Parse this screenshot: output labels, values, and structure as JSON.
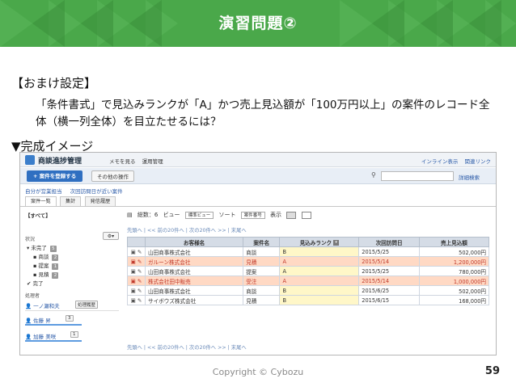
{
  "slide": {
    "title": "演習問題②",
    "heading": "【おまけ設定】",
    "question": "「条件書式」で見込みランクが「A」かつ売上見込額が「100万円以上」の案件のレコード全体（横一列全体）を目立たせるには？",
    "result_heading": "▼完成イメージ",
    "copyright": "Copyright © Cybozu",
    "page_number": "59",
    "header_color": "#4aa84a"
  },
  "app": {
    "name": "商談進捗管理",
    "title_links": [
      "メモを見る",
      "運用管理"
    ],
    "right_links": [
      "インライン表示",
      "関連リンク"
    ],
    "add_button": "+ 案件を登録する",
    "other_ops": "その他の操作",
    "advanced_search": "詳細検索",
    "filters": [
      "自分が営業担当",
      "次回訪問日が近い案件"
    ],
    "view_tabs": [
      "案件一覧",
      "集計",
      "発信履歴"
    ],
    "list_controls": {
      "total_label": "総数：6",
      "view_label": "ビュー",
      "view_value": "標準ビュー",
      "sort_label": "ソート",
      "sort_value": "案件番号",
      "display_label": "表示"
    },
    "pager": "先頭へ | << 前の20件へ | 次の20件へ >> | 末尾へ",
    "sidebar": {
      "all": "【すべて】",
      "status_label": "状況",
      "statuses": [
        {
          "label": "未完了",
          "count": "5"
        },
        {
          "label": "商談",
          "count": "2"
        },
        {
          "label": "提案",
          "count": "1"
        },
        {
          "label": "見積",
          "count": "2"
        },
        {
          "label": "完了",
          "count": ""
        }
      ],
      "assignee_label": "処理者",
      "users": [
        {
          "name": "一ノ瀬和夫",
          "tag": "処理履歴"
        },
        {
          "name": "佐藤 昇",
          "tag": "3"
        },
        {
          "name": "加藤 美咲",
          "tag": "1"
        }
      ]
    },
    "table": {
      "headers": [
        "お客様名",
        "案件名",
        "見込みランク",
        "次回訪問日",
        "売上見込額"
      ],
      "rows": [
        {
          "customer": "山田商事株式会社",
          "deal": "商談",
          "rank": "B",
          "date": "2015/5/25",
          "amount": "502,000円",
          "highlight": false
        },
        {
          "customer": "ガルーン株式会社",
          "deal": "見積",
          "rank": "A",
          "date": "2015/5/14",
          "amount": "1,200,000円",
          "highlight": true
        },
        {
          "customer": "山田商事株式会社",
          "deal": "提案",
          "rank": "A",
          "date": "2015/5/25",
          "amount": "780,000円",
          "highlight": false
        },
        {
          "customer": "株式会社田中販売",
          "deal": "受注",
          "rank": "A",
          "date": "2015/5/14",
          "amount": "1,000,000円",
          "highlight": true
        },
        {
          "customer": "山田商事株式会社",
          "deal": "商談",
          "rank": "B",
          "date": "2015/6/25",
          "amount": "502,000円",
          "highlight": false
        },
        {
          "customer": "サイボウズ株式会社",
          "deal": "見積",
          "rank": "B",
          "date": "2015/6/15",
          "amount": "168,000円",
          "highlight": false
        }
      ]
    }
  }
}
